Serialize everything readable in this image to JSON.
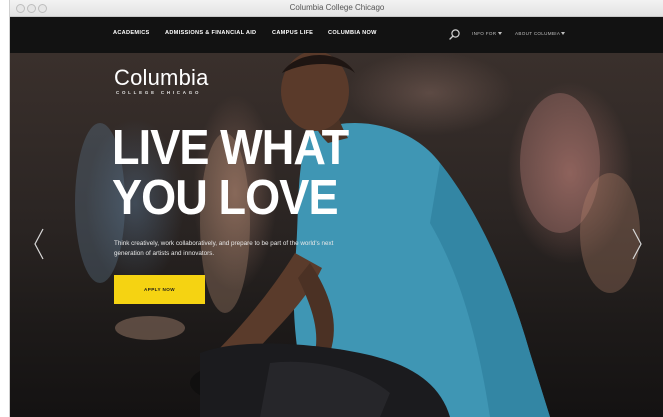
{
  "window": {
    "title": "Columbia College Chicago"
  },
  "nav": {
    "items": [
      "ACADEMICS",
      "ADMISSIONS & FINANCIAL AID",
      "CAMPUS LIFE",
      "COLUMBIA NOW"
    ],
    "util": [
      "INFO FOR",
      "ABOUT COLUMBIA"
    ],
    "search_icon": "search-icon"
  },
  "hero": {
    "logo_word": "Columbia",
    "logo_sub": "COLLEGE CHICAGO",
    "headline_1": "LIVE WHAT",
    "headline_2": "YOU LOVE",
    "tagline": "Think creatively, work collaboratively, and prepare to be part of the world's next generation of artists and innovators.",
    "apply_label": "APPLY NOW",
    "apply_color": "#f5d312",
    "prev_icon": "chevron-left-icon",
    "next_icon": "chevron-right-icon"
  }
}
